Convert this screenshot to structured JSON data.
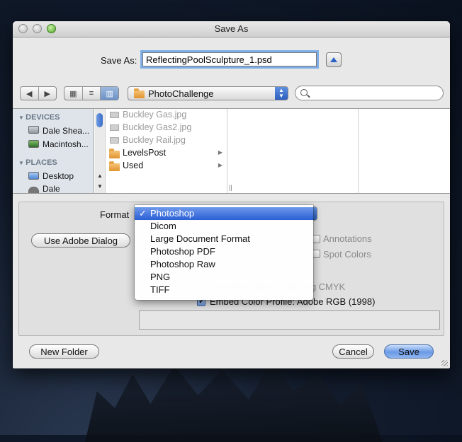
{
  "window": {
    "title": "Save As"
  },
  "save": {
    "label": "Save As:",
    "filename": "ReflectingPoolSculpture_1.psd"
  },
  "toolbar": {
    "view_icons": "▦",
    "view_list": "≡",
    "view_columns": "▥",
    "path": "PhotoChallenge",
    "search_placeholder": ""
  },
  "sidebar": {
    "devices_header": "DEVICES",
    "devices": [
      "Dale Shea...",
      "Macintosh..."
    ],
    "places_header": "PLACES",
    "places": [
      "Desktop",
      "Dale"
    ]
  },
  "files": [
    {
      "name": "Buckley Gas.jpg",
      "type": "image",
      "dim": true
    },
    {
      "name": "Buckley Gas2.jpg",
      "type": "image",
      "dim": true
    },
    {
      "name": "Buckley Rail.jpg",
      "type": "image",
      "dim": true
    },
    {
      "name": "LevelsPost",
      "type": "folder",
      "dim": false
    },
    {
      "name": "Used",
      "type": "folder",
      "dim": false
    }
  ],
  "options": {
    "format_label": "Format",
    "use_adobe_dialog": "Use Adobe Dialog",
    "annotations": "Annotations",
    "spot_colors": "Spot Colors",
    "use_proof_setup": "Use Proof Setup:  Working CMYK",
    "embed_color_profile": "Embed Color Profile:  Adobe RGB (1998)"
  },
  "format_menu": {
    "selected": "Photoshop",
    "items": [
      "Photoshop",
      "Dicom",
      "Large Document Format",
      "Photoshop PDF",
      "Photoshop Raw",
      "PNG",
      "TIFF"
    ]
  },
  "buttons": {
    "new_folder": "New Folder",
    "cancel": "Cancel",
    "save": "Save"
  },
  "colors": {
    "accent": "#2a5fd6",
    "sidebar_bg": "#dee4ea",
    "window_bg": "#e8e8e8"
  }
}
